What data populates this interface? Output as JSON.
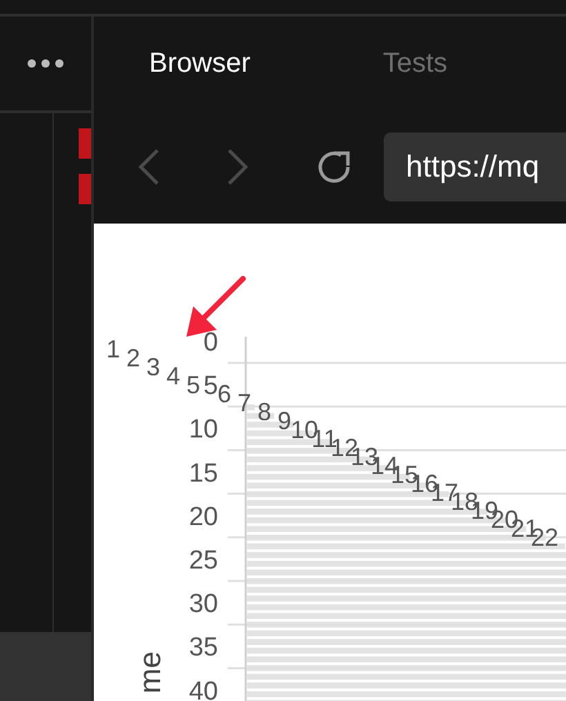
{
  "tabs": [
    {
      "label": "Browser",
      "selected": true
    },
    {
      "label": "Tests",
      "selected": false
    }
  ],
  "toolbar": {
    "back": {
      "disabled": true
    },
    "forward": {
      "disabled": true
    },
    "url": {
      "value": "https://mq"
    }
  },
  "chart": {
    "ylabel": "me",
    "y_ticks": [
      "0",
      "5",
      "10",
      "15",
      "20",
      "25",
      "30",
      "35",
      "40"
    ],
    "category_labels": [
      "1",
      "2",
      "3",
      "4",
      "5",
      "6",
      "7",
      "8",
      "9",
      "10",
      "11",
      "12",
      "13",
      "14",
      "15",
      "16",
      "17",
      "18",
      "19",
      "20",
      "21",
      "22"
    ]
  }
}
